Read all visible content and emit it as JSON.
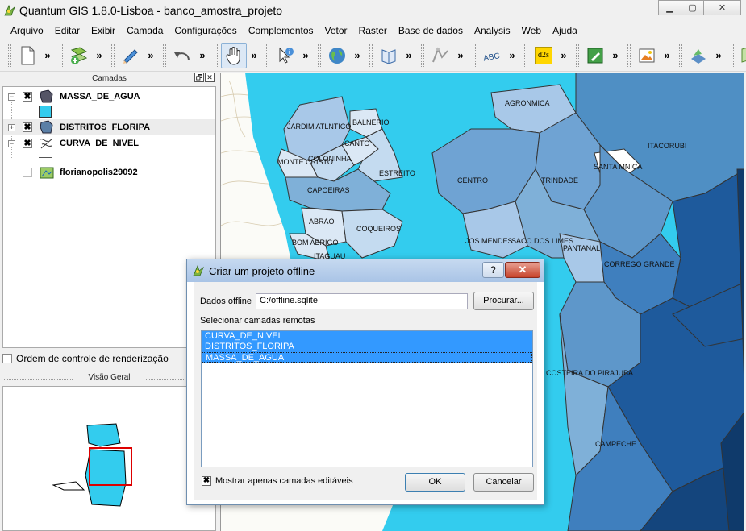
{
  "window": {
    "title": "Quantum GIS 1.8.0-Lisboa - banco_amostra_projeto",
    "minimize": "▁",
    "maximize": "▢",
    "close": "✕"
  },
  "menu": [
    "Arquivo",
    "Editar",
    "Exibir",
    "Camada",
    "Configurações",
    "Complementos",
    "Vetor",
    "Raster",
    "Base de dados",
    "Analysis",
    "Web",
    "Ajuda"
  ],
  "toolbar": {
    "more": "»",
    "groups": [
      {
        "icon": "new-project-icon"
      },
      {
        "icon": "add-layer-icon"
      },
      {
        "icon": "edit-pencil-icon"
      },
      {
        "icon": "undo-icon"
      },
      {
        "icon": "pan-hand-icon",
        "active": true
      },
      {
        "icon": "identify-icon"
      },
      {
        "icon": "globe-icon"
      },
      {
        "icon": "help-book-icon"
      },
      {
        "icon": "gps-icon"
      },
      {
        "icon": "label-abc-icon"
      },
      {
        "icon": "d2s-icon",
        "text": "d2s"
      },
      {
        "icon": "plugin-edit-icon"
      },
      {
        "icon": "image-icon"
      },
      {
        "icon": "raster-icon"
      },
      {
        "icon": "map-add-icon"
      }
    ]
  },
  "layers_panel": {
    "title": "Camadas",
    "float_button": "🗗",
    "close_button": "✕",
    "layers": [
      {
        "name": "MASSA_DE_AGUA",
        "checked": "✖",
        "expanded": "−",
        "swatch_color": "#33ccee"
      },
      {
        "name": "DISTRITOS_FLORIPA",
        "checked": "✖",
        "expanded": "+"
      },
      {
        "name": "CURVA_DE_NIVEL",
        "checked": "✖",
        "expanded": "−"
      },
      {
        "name": "florianopolis29092",
        "checked": ""
      }
    ]
  },
  "render_order": {
    "label": "Ordem de controle de renderização"
  },
  "overview": {
    "title": "Visão Geral"
  },
  "map": {
    "water_color": "#33ccee",
    "labels": [
      "AGRONMICA",
      "JARDIM ATLNTICO",
      "BALNERIO",
      "CANTO",
      "COLONINHA",
      "MONTE CRISTO",
      "ESTREITO",
      "CENTRO",
      "TRINDADE",
      "ITACORUBI",
      "SANTA MNICA",
      "CAPOEIRAS",
      "ABRAO",
      "COQUEIROS",
      "BOM ABRIGO",
      "ITAGUAU",
      "JOS MENDES",
      "SACO DOS LIMES",
      "PANTANAL",
      "CORREGO GRANDE",
      "COSTEIRA DO PIRAJUBA",
      "CAMPECHE"
    ]
  },
  "dialog": {
    "title": "Criar um projeto offline",
    "help": "?",
    "close": "✕",
    "data_label": "Dados offline",
    "data_value": "C:/offline.sqlite",
    "browse_button": "Procurar...",
    "remote_label": "Selecionar camadas remotas",
    "remote_layers": [
      "CURVA_DE_NIVEL",
      "DISTRITOS_FLORIPA",
      "MASSA_DE_AGUA"
    ],
    "editable_only_label": "Mostrar apenas camadas editáveis",
    "editable_only_checked": "✖",
    "ok_button": "OK",
    "cancel_button": "Cancelar"
  }
}
